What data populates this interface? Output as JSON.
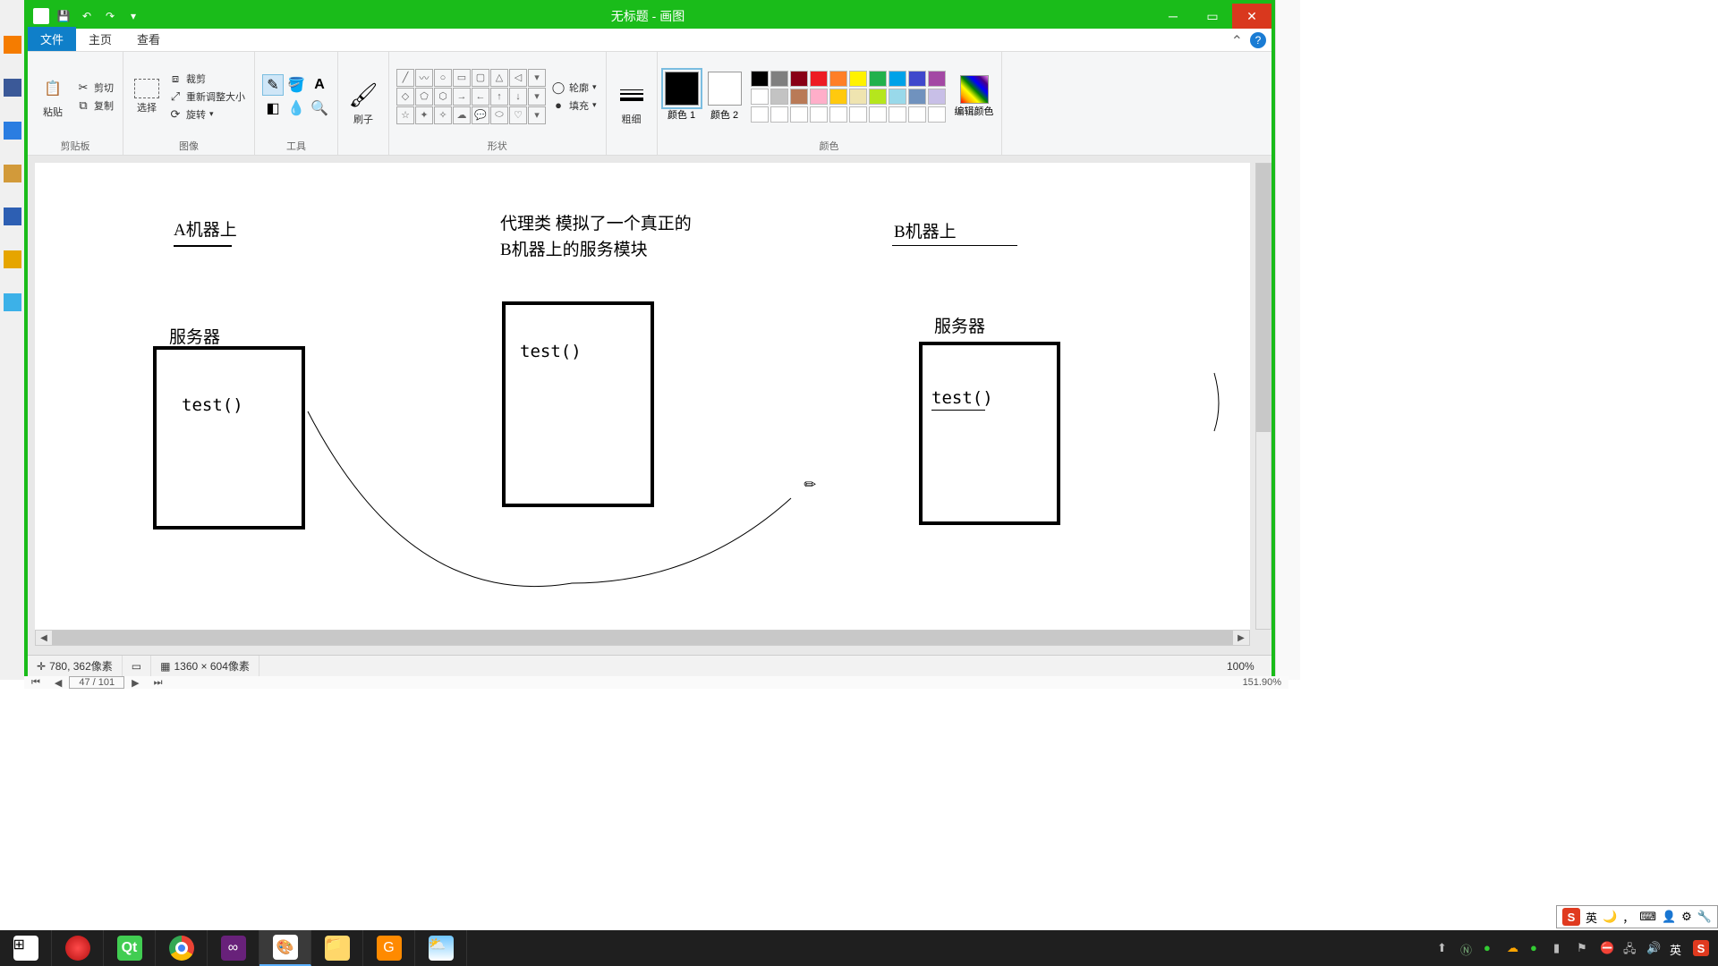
{
  "window": {
    "title": "无标题 - 画图"
  },
  "tabs": {
    "file": "文件",
    "home": "主页",
    "view": "查看"
  },
  "ribbon": {
    "clipboard": {
      "paste": "粘贴",
      "cut": "剪切",
      "copy": "复制",
      "group": "剪贴板"
    },
    "image": {
      "select": "选择",
      "crop": "裁剪",
      "resize": "重新调整大小",
      "rotate": "旋转",
      "group": "图像"
    },
    "tools": {
      "group": "工具"
    },
    "brush": {
      "label": "刷子"
    },
    "shapes": {
      "outline": "轮廓",
      "fill": "填充",
      "group": "形状"
    },
    "thickness": {
      "label": "粗细"
    },
    "colors": {
      "c1": "颜色 1",
      "c2": "颜色 2",
      "edit": "编辑颜色",
      "group": "颜色"
    }
  },
  "canvas": {
    "labelA": "A机器上",
    "labelProxy": "代理类   模拟了一个真正的B机器上的服务模块",
    "labelB": "B机器上",
    "serverA": "服务器",
    "serverB": "服务器",
    "test": "test()"
  },
  "status": {
    "coords": "780, 362像素",
    "size": "1360 × 604像素",
    "zoom": "100%"
  },
  "pager": {
    "page": "47 / 101",
    "zoom": "151.90%"
  },
  "ime": {
    "lang": "英"
  },
  "colors_palette_row1": [
    "#000000",
    "#7f7f7f",
    "#880015",
    "#ed1c24",
    "#ff7f27",
    "#fff200",
    "#22b14c",
    "#00a2e8",
    "#3f48cc",
    "#a349a4"
  ],
  "colors_palette_row2": [
    "#ffffff",
    "#c3c3c3",
    "#b97a57",
    "#ffaec9",
    "#ffc90e",
    "#efe4b0",
    "#b5e61d",
    "#99d9ea",
    "#7092be",
    "#c8bfe7"
  ],
  "colors_palette_row3": [
    "#ffffff",
    "#ffffff",
    "#ffffff",
    "#ffffff",
    "#ffffff",
    "#ffffff",
    "#ffffff",
    "#ffffff",
    "#ffffff",
    "#ffffff"
  ]
}
